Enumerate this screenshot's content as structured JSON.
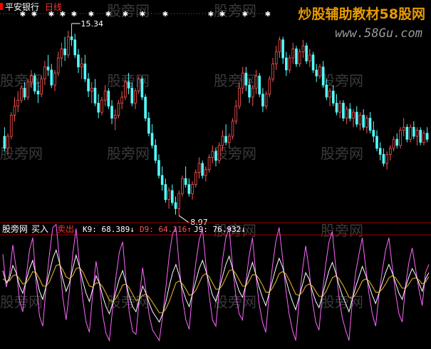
{
  "chart_data": [
    {
      "type": "candlestick",
      "title": "平安银行",
      "period_label": "日线",
      "annotations": [
        {
          "text": "15.34",
          "price": 15.34,
          "index": 20
        },
        {
          "text": "8.97",
          "price": 8.97,
          "index": 52
        }
      ],
      "candles": [
        [
          11.6,
          11.9,
          11.1,
          11.2
        ],
        [
          11.2,
          11.7,
          11.0,
          11.6
        ],
        [
          11.6,
          12.4,
          11.5,
          12.3
        ],
        [
          12.3,
          12.9,
          12.1,
          12.6
        ],
        [
          12.6,
          13.1,
          12.4,
          12.8
        ],
        [
          12.8,
          13.3,
          12.7,
          13.2
        ],
        [
          13.2,
          13.4,
          12.8,
          12.9
        ],
        [
          12.9,
          13.5,
          12.8,
          13.4
        ],
        [
          13.4,
          13.8,
          13.2,
          13.6
        ],
        [
          13.6,
          13.7,
          13.0,
          13.1
        ],
        [
          13.1,
          13.4,
          12.7,
          13.0
        ],
        [
          13.0,
          13.6,
          12.9,
          13.5
        ],
        [
          13.5,
          14.1,
          13.3,
          13.9
        ],
        [
          13.9,
          14.3,
          13.6,
          13.8
        ],
        [
          13.8,
          14.0,
          13.2,
          13.3
        ],
        [
          13.3,
          13.8,
          13.1,
          13.7
        ],
        [
          13.7,
          14.4,
          13.6,
          14.2
        ],
        [
          14.2,
          14.7,
          13.9,
          14.5
        ],
        [
          14.5,
          14.9,
          14.1,
          14.3
        ],
        [
          14.3,
          15.1,
          14.2,
          14.9
        ],
        [
          14.9,
          15.34,
          14.6,
          14.8
        ],
        [
          14.8,
          15.0,
          14.2,
          14.3
        ],
        [
          14.3,
          14.5,
          13.7,
          13.9
        ],
        [
          13.9,
          14.2,
          13.5,
          14.0
        ],
        [
          14.0,
          14.3,
          13.4,
          13.5
        ],
        [
          13.5,
          13.7,
          12.9,
          13.1
        ],
        [
          13.1,
          13.4,
          12.7,
          13.2
        ],
        [
          13.2,
          13.5,
          12.6,
          12.7
        ],
        [
          12.7,
          13.0,
          12.2,
          12.4
        ],
        [
          12.4,
          12.9,
          12.3,
          12.8
        ],
        [
          12.8,
          13.3,
          12.6,
          13.1
        ],
        [
          13.1,
          13.2,
          12.5,
          12.6
        ],
        [
          12.6,
          12.8,
          12.0,
          12.2
        ],
        [
          12.2,
          12.5,
          11.8,
          12.3
        ],
        [
          12.3,
          12.8,
          12.2,
          12.7
        ],
        [
          12.7,
          13.1,
          12.5,
          12.9
        ],
        [
          12.9,
          13.5,
          12.8,
          13.4
        ],
        [
          13.4,
          13.7,
          13.0,
          13.2
        ],
        [
          13.2,
          13.4,
          12.6,
          12.7
        ],
        [
          12.7,
          13.2,
          12.5,
          13.1
        ],
        [
          13.1,
          13.6,
          13.0,
          13.5
        ],
        [
          13.5,
          13.6,
          12.8,
          12.9
        ],
        [
          12.9,
          13.0,
          12.1,
          12.2
        ],
        [
          12.2,
          12.4,
          11.6,
          11.7
        ],
        [
          11.7,
          12.0,
          11.2,
          11.3
        ],
        [
          11.3,
          11.5,
          10.7,
          10.8
        ],
        [
          10.8,
          11.0,
          10.2,
          10.3
        ],
        [
          10.3,
          10.6,
          9.8,
          10.0
        ],
        [
          10.0,
          10.2,
          9.4,
          9.5
        ],
        [
          9.5,
          9.9,
          9.2,
          9.8
        ],
        [
          9.8,
          10.0,
          9.3,
          9.4
        ],
        [
          9.4,
          9.6,
          9.0,
          9.2
        ],
        [
          9.2,
          9.8,
          8.97,
          9.7
        ],
        [
          9.7,
          10.3,
          9.6,
          10.2
        ],
        [
          10.2,
          10.6,
          9.9,
          10.0
        ],
        [
          10.0,
          10.2,
          9.6,
          9.7
        ],
        [
          9.7,
          10.1,
          9.5,
          10.0
        ],
        [
          10.0,
          10.5,
          9.9,
          10.4
        ],
        [
          10.4,
          10.9,
          10.2,
          10.7
        ],
        [
          10.7,
          10.8,
          10.2,
          10.3
        ],
        [
          10.3,
          10.6,
          10.1,
          10.5
        ],
        [
          10.5,
          11.0,
          10.4,
          10.9
        ],
        [
          10.9,
          11.3,
          10.7,
          11.1
        ],
        [
          11.1,
          11.2,
          10.6,
          10.8
        ],
        [
          10.8,
          11.4,
          10.7,
          11.3
        ],
        [
          11.3,
          11.8,
          11.1,
          11.6
        ],
        [
          11.6,
          12.0,
          11.3,
          11.4
        ],
        [
          11.4,
          11.7,
          11.2,
          11.6
        ],
        [
          11.6,
          12.2,
          11.5,
          12.1
        ],
        [
          12.1,
          12.8,
          12.0,
          12.6
        ],
        [
          12.6,
          13.4,
          12.5,
          13.2
        ],
        [
          13.2,
          13.9,
          13.0,
          13.7
        ],
        [
          13.7,
          13.9,
          13.1,
          13.3
        ],
        [
          13.3,
          13.5,
          12.7,
          12.9
        ],
        [
          12.9,
          13.3,
          12.6,
          13.2
        ],
        [
          13.2,
          13.8,
          13.0,
          13.6
        ],
        [
          13.6,
          13.7,
          12.9,
          13.0
        ],
        [
          13.0,
          13.2,
          12.4,
          12.6
        ],
        [
          12.6,
          13.1,
          12.5,
          13.0
        ],
        [
          13.0,
          13.6,
          12.9,
          13.5
        ],
        [
          13.5,
          14.2,
          13.4,
          14.0
        ],
        [
          14.0,
          14.6,
          13.8,
          14.4
        ],
        [
          14.4,
          14.9,
          14.2,
          14.8
        ],
        [
          14.8,
          14.9,
          14.0,
          14.2
        ],
        [
          14.2,
          14.4,
          13.6,
          13.8
        ],
        [
          13.8,
          14.3,
          13.7,
          14.2
        ],
        [
          14.2,
          14.7,
          14.0,
          14.5
        ],
        [
          14.5,
          14.6,
          13.9,
          14.0
        ],
        [
          14.0,
          14.5,
          13.9,
          14.4
        ],
        [
          14.4,
          14.8,
          14.2,
          14.6
        ],
        [
          14.6,
          14.7,
          14.0,
          14.1
        ],
        [
          14.1,
          14.5,
          13.9,
          14.3
        ],
        [
          14.3,
          14.4,
          13.7,
          13.8
        ],
        [
          13.8,
          14.0,
          13.4,
          13.6
        ],
        [
          13.6,
          14.0,
          13.5,
          13.9
        ],
        [
          13.9,
          14.1,
          13.2,
          13.3
        ],
        [
          13.3,
          13.5,
          12.8,
          12.9
        ],
        [
          12.9,
          13.2,
          12.6,
          13.1
        ],
        [
          13.1,
          13.3,
          12.6,
          12.7
        ],
        [
          12.7,
          13.0,
          12.3,
          12.4
        ],
        [
          12.4,
          12.8,
          12.2,
          12.7
        ],
        [
          12.7,
          12.8,
          12.1,
          12.2
        ],
        [
          12.2,
          12.6,
          12.0,
          12.5
        ],
        [
          12.5,
          12.7,
          12.1,
          12.2
        ],
        [
          12.2,
          12.5,
          11.9,
          12.4
        ],
        [
          12.4,
          12.6,
          11.9,
          12.0
        ],
        [
          12.0,
          12.4,
          11.8,
          12.3
        ],
        [
          12.3,
          12.5,
          11.8,
          11.9
        ],
        [
          11.9,
          12.3,
          11.7,
          12.2
        ],
        [
          12.2,
          12.4,
          11.7,
          11.8
        ],
        [
          11.8,
          12.1,
          11.4,
          11.6
        ],
        [
          11.6,
          11.8,
          11.1,
          11.2
        ],
        [
          11.2,
          11.4,
          10.8,
          11.0
        ],
        [
          11.0,
          11.2,
          10.6,
          10.7
        ],
        [
          10.7,
          11.1,
          10.5,
          11.0
        ],
        [
          11.0,
          11.3,
          10.8,
          11.2
        ],
        [
          11.2,
          11.6,
          11.1,
          11.5
        ],
        [
          11.5,
          11.7,
          11.2,
          11.3
        ],
        [
          11.3,
          11.9,
          11.2,
          11.8
        ],
        [
          11.8,
          12.2,
          11.6,
          11.9
        ],
        [
          11.9,
          12.0,
          11.4,
          11.5
        ],
        [
          11.5,
          12.0,
          11.4,
          11.9
        ],
        [
          11.9,
          12.1,
          11.5,
          11.6
        ],
        [
          11.6,
          11.9,
          11.3,
          11.8
        ],
        [
          11.8,
          11.9,
          11.3,
          11.4
        ],
        [
          11.4,
          11.8,
          11.3,
          11.7
        ],
        [
          11.7,
          11.9,
          11.4,
          11.5
        ]
      ],
      "ylim": [
        8.9,
        15.6
      ]
    },
    {
      "type": "line",
      "title": "股旁网",
      "buy_label": "买入",
      "sell_label": "卖出",
      "readouts": [
        {
          "name": "K9",
          "text": "K9: 68.389↓"
        },
        {
          "name": "D9",
          "text": "D9: 64.116↑"
        },
        {
          "name": "J9",
          "text": "J9: 76.932↓"
        }
      ],
      "ylim": [
        0,
        100
      ],
      "series": [
        {
          "name": "K9",
          "values": [
            70,
            58,
            62,
            75,
            68,
            55,
            48,
            60,
            72,
            80,
            65,
            50,
            42,
            55,
            68,
            82,
            90,
            78,
            62,
            50,
            58,
            72,
            85,
            74,
            60,
            48,
            40,
            52,
            65,
            58,
            45,
            35,
            28,
            38,
            50,
            62,
            70,
            58,
            45,
            35,
            30,
            42,
            55,
            48,
            38,
            30,
            25,
            20,
            28,
            40,
            55,
            68,
            76,
            65,
            52,
            42,
            35,
            48,
            60,
            72,
            80,
            70,
            58,
            46,
            40,
            52,
            64,
            76,
            84,
            72,
            60,
            50,
            44,
            56,
            68,
            78,
            66,
            54,
            44,
            36,
            48,
            60,
            72,
            82,
            74,
            62,
            50,
            40,
            32,
            44,
            56,
            68,
            62,
            50,
            40,
            34,
            46,
            58,
            70,
            78,
            68,
            56,
            46,
            38,
            30,
            42,
            54,
            64,
            74,
            66,
            56,
            46,
            38,
            48,
            58,
            68,
            76,
            68,
            58,
            48,
            42,
            54,
            64,
            72,
            66,
            58,
            50,
            62,
            68
          ]
        },
        {
          "name": "D9",
          "values": [
            62,
            60,
            60,
            65,
            66,
            62,
            57,
            58,
            63,
            69,
            68,
            62,
            55,
            55,
            59,
            67,
            75,
            76,
            71,
            64,
            62,
            65,
            72,
            73,
            69,
            62,
            55,
            54,
            58,
            58,
            54,
            48,
            41,
            40,
            43,
            49,
            56,
            57,
            53,
            47,
            41,
            42,
            46,
            47,
            44,
            39,
            34,
            29,
            29,
            33,
            40,
            49,
            58,
            60,
            57,
            52,
            46,
            47,
            51,
            58,
            65,
            67,
            64,
            58,
            52,
            52,
            56,
            63,
            70,
            71,
            67,
            61,
            55,
            55,
            60,
            66,
            66,
            62,
            56,
            49,
            49,
            53,
            59,
            67,
            69,
            67,
            61,
            54,
            47,
            46,
            49,
            55,
            57,
            55,
            50,
            45,
            45,
            49,
            56,
            63,
            65,
            62,
            57,
            51,
            44,
            43,
            47,
            53,
            60,
            62,
            60,
            55,
            49,
            49,
            52,
            57,
            63,
            65,
            63,
            58,
            53,
            53,
            57,
            62,
            63,
            61,
            57,
            59,
            64
          ]
        },
        {
          "name": "J9",
          "values": [
            86,
            54,
            66,
            95,
            72,
            41,
            30,
            64,
            90,
            102,
            59,
            26,
            16,
            55,
            86,
            112,
            120,
            82,
            44,
            22,
            50,
            86,
            111,
            76,
            42,
            20,
            10,
            48,
            79,
            58,
            27,
            9,
            2,
            34,
            64,
            88,
            98,
            60,
            29,
            11,
            8,
            42,
            73,
            50,
            26,
            12,
            7,
            2,
            26,
            54,
            85,
            106,
            112,
            75,
            42,
            22,
            13,
            50,
            78,
            100,
            110,
            76,
            46,
            22,
            16,
            52,
            80,
            102,
            112,
            74,
            46,
            28,
            22,
            58,
            84,
            102,
            66,
            38,
            20,
            10,
            46,
            74,
            98,
            112,
            84,
            52,
            28,
            12,
            2,
            40,
            70,
            94,
            72,
            40,
            20,
            12,
            48,
            76,
            98,
            108,
            74,
            44,
            24,
            12,
            2,
            40,
            68,
            86,
            102,
            74,
            48,
            28,
            16,
            46,
            70,
            90,
            102,
            74,
            48,
            28,
            20,
            56,
            78,
            92,
            72,
            52,
            36,
            68,
            76
          ]
        }
      ]
    }
  ],
  "watermark": {
    "site_text": "炒股辅助教材58股网",
    "url_text": "www.58Gu.com",
    "tile_text": "股旁网"
  },
  "colors": {
    "up": "#ff5555",
    "down": "#55ffff",
    "divider": "#a00000",
    "k": "#ffffff",
    "d": "#d4a020",
    "j": "#ff66ff",
    "title": "#ffffff",
    "sell": "#ff3030",
    "buy": "#ffffff"
  }
}
